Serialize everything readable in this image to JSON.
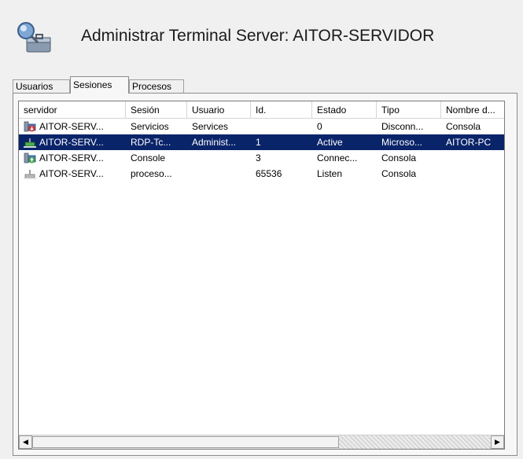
{
  "header": {
    "title": "Administrar Terminal Server: AITOR-SERVIDOR",
    "icon": "server-toolbox-icon"
  },
  "tabs": [
    {
      "label": "Usuarios",
      "active": false
    },
    {
      "label": "Sesiones",
      "active": true
    },
    {
      "label": "Procesos",
      "active": false
    }
  ],
  "table": {
    "columns": [
      "servidor",
      "Sesión",
      "Usuario",
      "Id.",
      "Estado",
      "Tipo",
      "Nombre d..."
    ],
    "rows": [
      {
        "icon": "session-disconnected-icon",
        "cells": [
          "AITOR-SERV...",
          "Servicios",
          "Services",
          "",
          "0",
          "Disconn...",
          "Consola"
        ],
        "selected": false
      },
      {
        "icon": "session-rdp-active-icon",
        "cells": [
          "AITOR-SERV...",
          "RDP-Tc...",
          "Administ...",
          "1",
          "Active",
          "Microso...",
          "AITOR-PC"
        ],
        "selected": true
      },
      {
        "icon": "session-console-connected-icon",
        "cells": [
          "AITOR-SERV...",
          "Console",
          "",
          "3",
          "Connec...",
          "Consola",
          ""
        ],
        "selected": false
      },
      {
        "icon": "session-listener-icon",
        "cells": [
          "AITOR-SERV...",
          "proceso...",
          "",
          "65536",
          "Listen",
          "Consola",
          ""
        ],
        "selected": false
      }
    ]
  },
  "scrollbar": {
    "left_arrow": "◀",
    "right_arrow": "▶"
  },
  "colors": {
    "selection": "#0a246a",
    "background": "#f0f0f0"
  }
}
